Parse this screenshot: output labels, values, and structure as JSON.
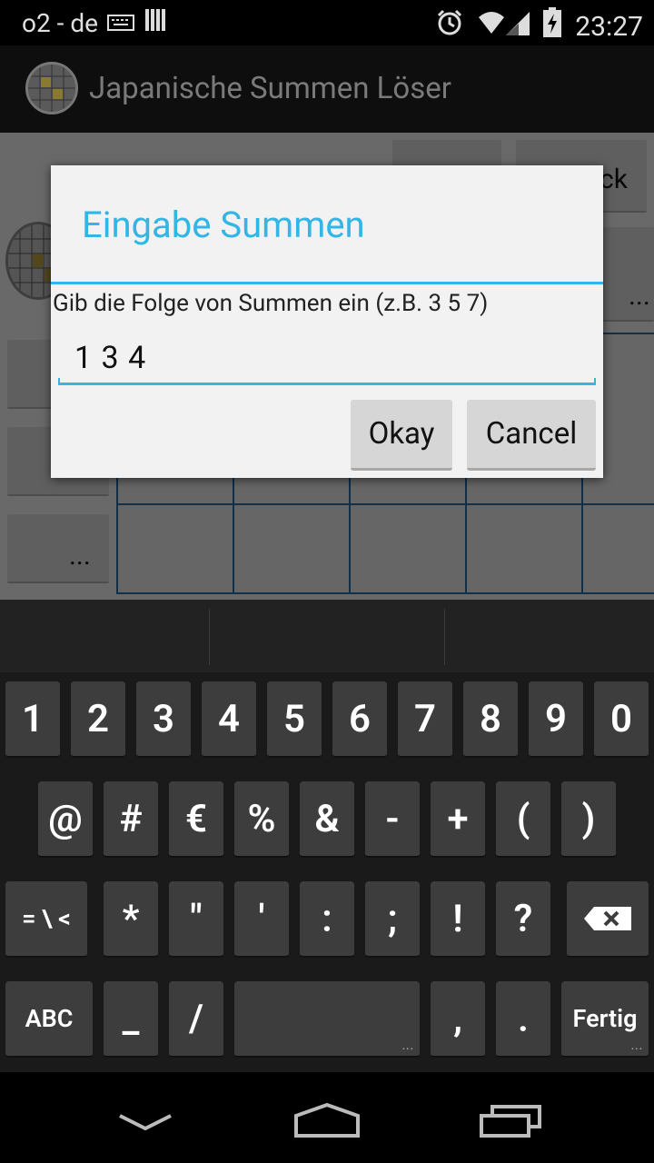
{
  "status_bar": {
    "carrier": "o2 - de",
    "time": "23:27"
  },
  "action_bar": {
    "title": "Japanische Summen Löser"
  },
  "background": {
    "top_button_right_fragment": "ck",
    "side_button_ellipsis": "...",
    "right_button_ellipsis": "..."
  },
  "dialog": {
    "title": "Eingabe Summen",
    "message": "Gib die Folge von Summen ein (z.B. 3 5 7)",
    "input_value": "1 3 4",
    "ok_label": "Okay",
    "cancel_label": "Cancel"
  },
  "keyboard": {
    "row1": [
      "1",
      "2",
      "3",
      "4",
      "5",
      "6",
      "7",
      "8",
      "9",
      "0"
    ],
    "row2": [
      "@",
      "#",
      "€",
      "%",
      "&",
      "-",
      "+",
      "(",
      ")"
    ],
    "row3": [
      "*",
      "\"",
      "'",
      ":",
      ";",
      "!",
      "?"
    ],
    "more_symbols_label": "= \\ <",
    "abc_label": "ABC",
    "underscore": "_",
    "slash": "/",
    "comma": ",",
    "period": ".",
    "done_label": "Fertig"
  },
  "colors": {
    "accent": "#33b5e5",
    "grid_line": "#2b6b9e"
  }
}
